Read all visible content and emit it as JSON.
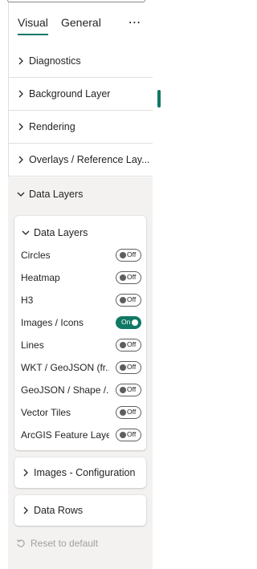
{
  "tabs": {
    "visual": "Visual",
    "general": "General",
    "more": "⋯"
  },
  "sections": [
    {
      "label": "Diagnostics"
    },
    {
      "label": "Background Layer"
    },
    {
      "label": "Rendering"
    },
    {
      "label": "Overlays / Reference Lay..."
    },
    {
      "label": "Data Layers"
    }
  ],
  "data_layers_card": {
    "title": "Data Layers",
    "rows": [
      {
        "label": "Circles",
        "state": "Off"
      },
      {
        "label": "Heatmap",
        "state": "Off"
      },
      {
        "label": "H3",
        "state": "Off"
      },
      {
        "label": "Images / Icons",
        "state": "On"
      },
      {
        "label": "Lines",
        "state": "Off"
      },
      {
        "label": "WKT / GeoJSON (fr...",
        "state": "Off"
      },
      {
        "label": "GeoJSON / Shape /...",
        "state": "Off"
      },
      {
        "label": "Vector Tiles",
        "state": "Off"
      },
      {
        "label": "ArcGIS Feature Layer",
        "state": "Off"
      }
    ]
  },
  "images_config_card": {
    "title": "Images - Configuration"
  },
  "data_rows_card": {
    "title": "Data Rows"
  },
  "reset": {
    "label": "Reset to default"
  },
  "colors": {
    "accent": "#117865",
    "disabled": "#a19f9d"
  }
}
